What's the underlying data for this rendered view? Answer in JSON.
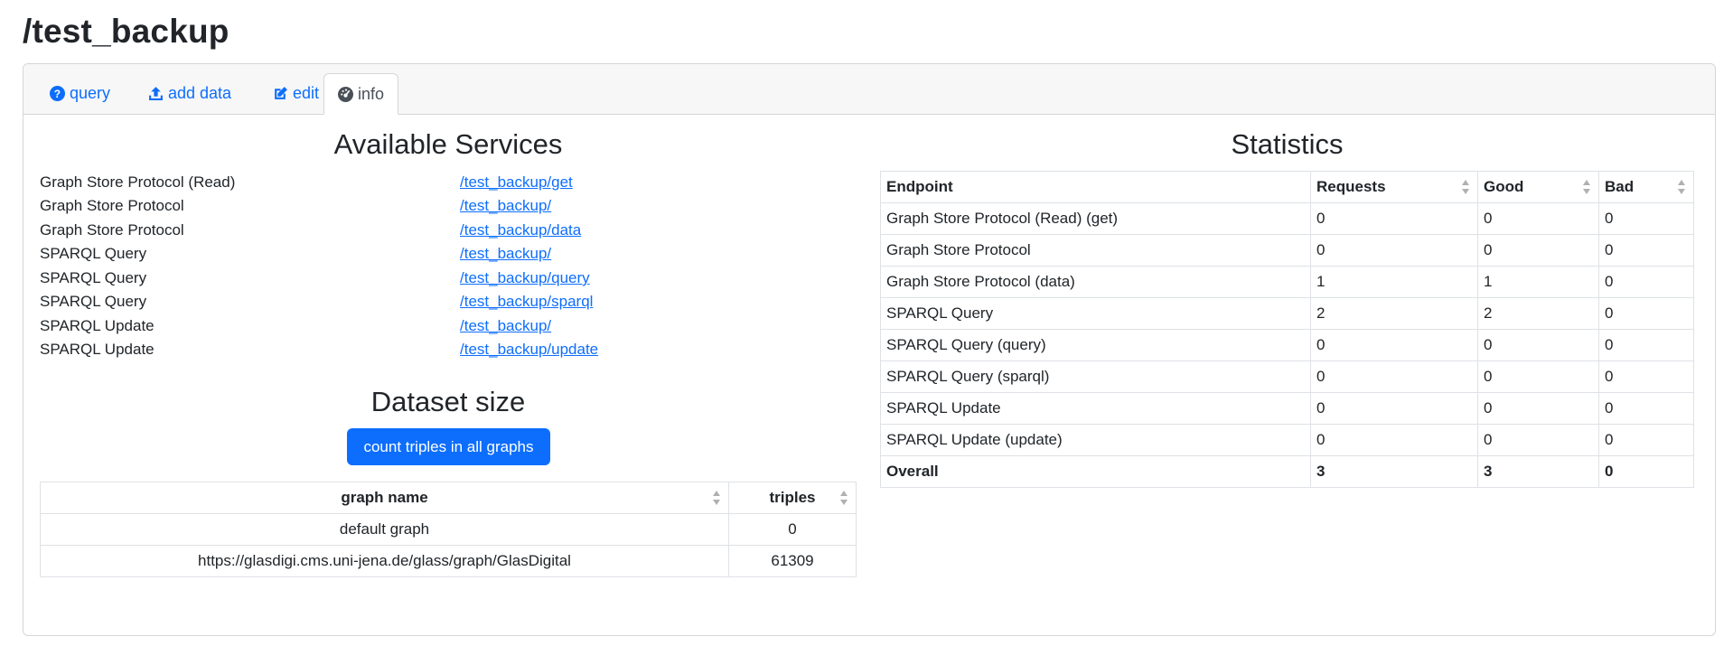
{
  "page": {
    "title": "/test_backup"
  },
  "tabs": [
    {
      "label": "query",
      "icon": "question-circle-icon"
    },
    {
      "label": "add data",
      "icon": "upload-icon"
    },
    {
      "label": "edit",
      "icon": "edit-icon"
    },
    {
      "label": "info",
      "icon": "dashboard-icon",
      "active": true
    }
  ],
  "services": {
    "title": "Available Services",
    "items": [
      {
        "name": "Graph Store Protocol (Read)",
        "link": "/test_backup/get"
      },
      {
        "name": "Graph Store Protocol",
        "link": "/test_backup/"
      },
      {
        "name": "Graph Store Protocol",
        "link": "/test_backup/data"
      },
      {
        "name": "SPARQL Query",
        "link": "/test_backup/"
      },
      {
        "name": "SPARQL Query",
        "link": "/test_backup/query"
      },
      {
        "name": "SPARQL Query",
        "link": "/test_backup/sparql"
      },
      {
        "name": "SPARQL Update",
        "link": "/test_backup/"
      },
      {
        "name": "SPARQL Update",
        "link": "/test_backup/update"
      }
    ]
  },
  "dataset": {
    "title": "Dataset size",
    "button_label": "count triples in all graphs",
    "columns": [
      "graph name",
      "triples"
    ],
    "rows": [
      [
        "default graph",
        "0"
      ],
      [
        "https://glasdigi.cms.uni-jena.de/glass/graph/GlasDigital",
        "61309"
      ]
    ]
  },
  "statistics": {
    "title": "Statistics",
    "columns": [
      "Endpoint",
      "Requests",
      "Good",
      "Bad"
    ],
    "rows": [
      [
        "Graph Store Protocol (Read) (get)",
        "0",
        "0",
        "0"
      ],
      [
        "Graph Store Protocol",
        "0",
        "0",
        "0"
      ],
      [
        "Graph Store Protocol (data)",
        "1",
        "1",
        "0"
      ],
      [
        "SPARQL Query",
        "2",
        "2",
        "0"
      ],
      [
        "SPARQL Query (query)",
        "0",
        "0",
        "0"
      ],
      [
        "SPARQL Query (sparql)",
        "0",
        "0",
        "0"
      ],
      [
        "SPARQL Update",
        "0",
        "0",
        "0"
      ],
      [
        "SPARQL Update (update)",
        "0",
        "0",
        "0"
      ]
    ],
    "total": [
      "Overall",
      "3",
      "3",
      "0"
    ]
  },
  "colors": {
    "accent": "#0d6efd",
    "border": "#dee2e6",
    "header_bg": "#f7f7f7"
  }
}
